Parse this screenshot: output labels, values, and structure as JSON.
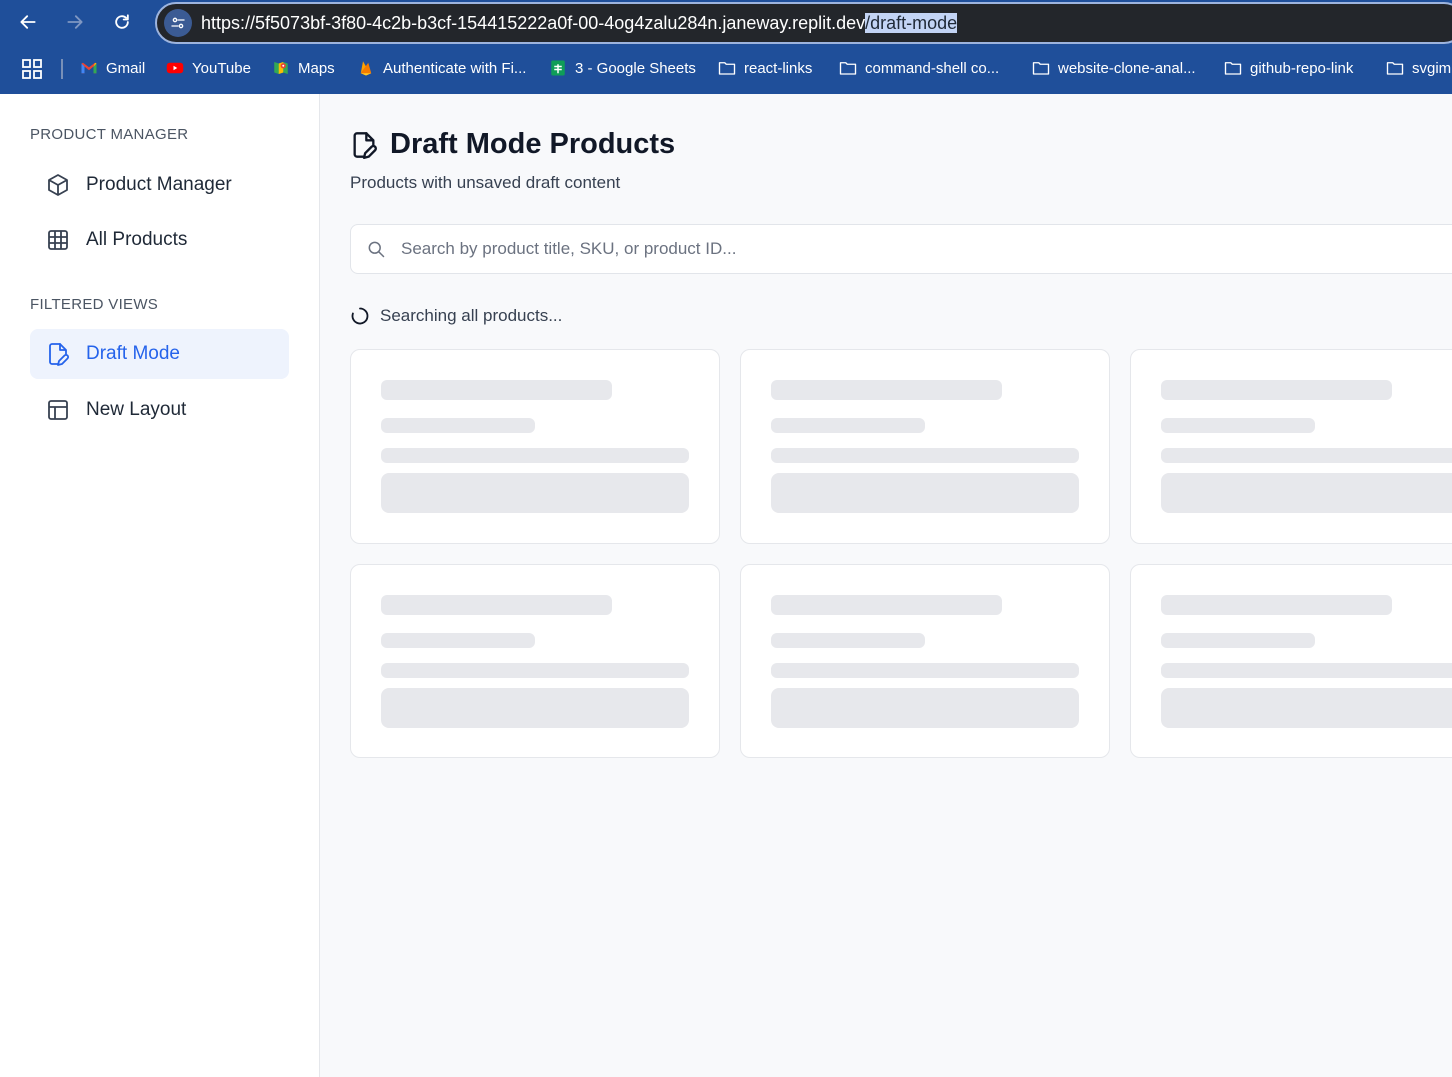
{
  "browser": {
    "url_main": "https://5f5073bf-3f80-4c2b-b3cf-154415222a0f-00-4og4zalu284n.janeway.replit.dev",
    "url_path": "/draft-mode",
    "bookmarks": [
      {
        "label": "Gmail",
        "icon": "gmail-icon"
      },
      {
        "label": "YouTube",
        "icon": "youtube-icon"
      },
      {
        "label": "Maps",
        "icon": "maps-icon"
      },
      {
        "label": "Authenticate with Fi...",
        "icon": "firebase-icon"
      },
      {
        "label": "3 - Google Sheets",
        "icon": "sheets-icon"
      },
      {
        "label": "react-links",
        "icon": "folder-icon"
      },
      {
        "label": "command-shell co...",
        "icon": "folder-icon"
      },
      {
        "label": "website-clone-anal...",
        "icon": "folder-icon"
      },
      {
        "label": "github-repo-link",
        "icon": "folder-icon"
      },
      {
        "label": "svgim",
        "icon": "folder-icon"
      }
    ]
  },
  "sidebar": {
    "section1": "PRODUCT MANAGER",
    "items1": [
      {
        "label": "Product Manager",
        "icon": "cube-icon"
      },
      {
        "label": "All Products",
        "icon": "grid-icon"
      }
    ],
    "section2": "FILTERED VIEWS",
    "items2": [
      {
        "label": "Draft Mode",
        "icon": "file-edit-icon",
        "active": true
      },
      {
        "label": "New Layout",
        "icon": "layout-icon"
      }
    ]
  },
  "main": {
    "title": "Draft Mode Products",
    "subtitle": "Products with unsaved draft content",
    "search_placeholder": "Search by product title, SKU, or product ID...",
    "status": "Searching all products..."
  },
  "colors": {
    "chrome": "#1f4f9a",
    "accent": "#2563eb",
    "active_bg": "#eef3fd",
    "skeleton": "#e7e8ec"
  }
}
